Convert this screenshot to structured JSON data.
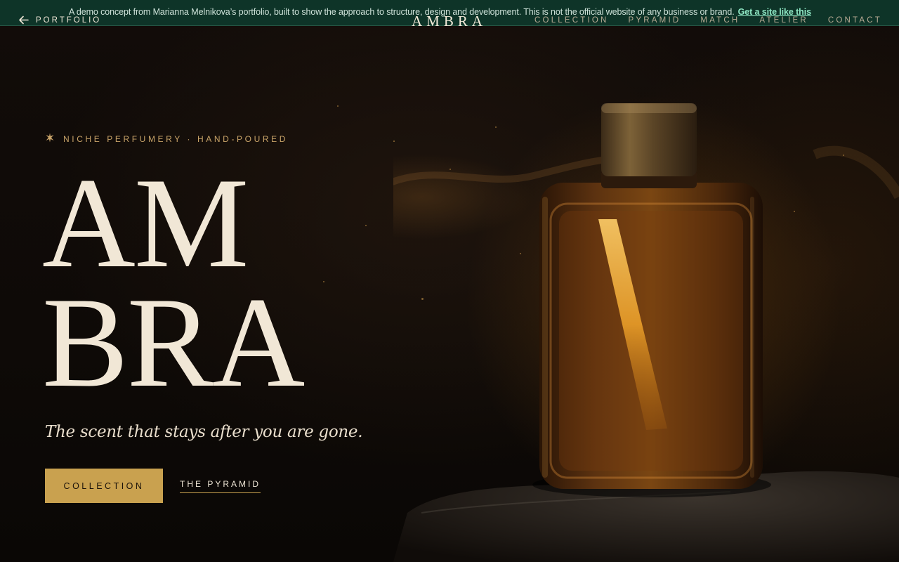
{
  "banner": {
    "text": "A demo concept from Marianna Melnikova’s portfolio, built to show the approach to structure, design and development. This is not the official website of any business or brand.",
    "link_label": "Get a site like this"
  },
  "header": {
    "back_label": "PORTFOLIO",
    "logo": "AMBRA",
    "nav": [
      "COLLECTION",
      "PYRAMID",
      "MATCH",
      "ATELIER",
      "CONTACT"
    ]
  },
  "hero": {
    "eyebrow": "NICHE PERFUMERY · HAND-POURED",
    "title_line1": "AM",
    "title_line2": "BRA",
    "tagline": "The scent that stays after you are gone.",
    "primary_button": "COLLECTION",
    "secondary_link": "THE PYRAMID"
  },
  "icons": {
    "back": "arrow-left-icon",
    "eyebrow": "sparkle-icon"
  },
  "colors": {
    "background": "#0d0907",
    "gold": "#c9a14f",
    "cream": "#f1e7d6",
    "banner": "#0e3a2c",
    "banner_link": "#8ee6c3"
  }
}
